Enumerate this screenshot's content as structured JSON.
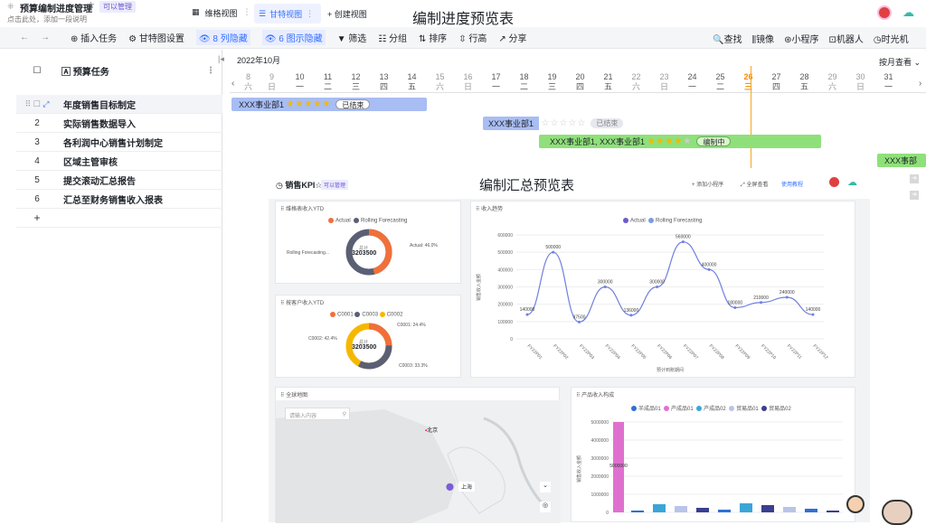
{
  "app": {
    "title": "预算编制进度管理",
    "star": "☆",
    "badge": "可以管理",
    "desc": "点击此处，添加一段说明",
    "tabs": [
      {
        "label": "维格视图"
      },
      {
        "label": "甘特视图"
      },
      {
        "label": "+ 创建视图"
      }
    ],
    "heading": "编制进度预览表"
  },
  "toolbar": {
    "insert": "插入任务",
    "gantt_settings": "甘特图设置",
    "hidden_cols": "8 列隐藏",
    "hidden_graphs": "6 图示隐藏",
    "filter": "筛选",
    "group": "分组",
    "sort": "排序",
    "row_height": "行高",
    "share": "分享",
    "search": "查找",
    "mirror": "镜像",
    "mini": "小程序",
    "robot": "机器人",
    "timemachine": "时光机"
  },
  "left": {
    "col_title": "预算任务",
    "add": "+",
    "rows": [
      {
        "num": "",
        "name": "年度销售目标制定"
      },
      {
        "num": "2",
        "name": "实际销售数据导入"
      },
      {
        "num": "3",
        "name": "各利润中心销售计划制定"
      },
      {
        "num": "4",
        "name": "区域主管审核"
      },
      {
        "num": "5",
        "name": "提交滚动汇总报告"
      },
      {
        "num": "6",
        "name": "汇总至财务销售收入报表"
      }
    ]
  },
  "calendar": {
    "month": "2022年10月",
    "view": "按月查看",
    "days": [
      {
        "d": "9",
        "w": "日"
      },
      {
        "d": "10",
        "w": "一"
      },
      {
        "d": "11",
        "w": "二"
      },
      {
        "d": "12",
        "w": "三"
      },
      {
        "d": "13",
        "w": "四"
      },
      {
        "d": "14",
        "w": "五"
      },
      {
        "d": "15",
        "w": "六"
      },
      {
        "d": "16",
        "w": "日"
      },
      {
        "d": "17",
        "w": "一"
      },
      {
        "d": "18",
        "w": "二"
      },
      {
        "d": "19",
        "w": "三"
      },
      {
        "d": "20",
        "w": "四"
      },
      {
        "d": "21",
        "w": "五"
      },
      {
        "d": "22",
        "w": "六"
      },
      {
        "d": "23",
        "w": "日"
      },
      {
        "d": "24",
        "w": "一"
      },
      {
        "d": "25",
        "w": "二"
      },
      {
        "d": "26",
        "w": "三"
      },
      {
        "d": "27",
        "w": "四"
      },
      {
        "d": "28",
        "w": "五"
      },
      {
        "d": "29",
        "w": "六"
      },
      {
        "d": "30",
        "w": "日"
      },
      {
        "d": "31",
        "w": "一"
      }
    ],
    "first": {
      "d": "8",
      "w": "六"
    }
  },
  "bars": [
    {
      "label": "XXX事业部1",
      "stars": 5,
      "status": "已结束"
    },
    {
      "label": "XXX事业部1",
      "stars": 0,
      "status": "已结束"
    },
    {
      "label": "XXX事业部1, XXX事业部1",
      "stars": 4,
      "status": "编制中"
    },
    {
      "label": "XXX事部"
    }
  ],
  "dashboard": {
    "title": "销售KPI",
    "badge": "可以管理",
    "heading": "编制汇总预览表",
    "add": "+ 添加小程序",
    "fullscreen": "全屏查看",
    "tutorial": "使用教程",
    "card1": {
      "title": "维格表收入YTD",
      "legend": [
        "Actual",
        "Rolling Forecasting"
      ],
      "total_label": "总计",
      "total": "3203500",
      "lbl_left": "Rolling Forecasting...",
      "lbl_right": "Actual: 46.0%"
    },
    "card2": {
      "title": "按客户收入YTD",
      "legend": [
        "C0001",
        "C0003",
        "C0002"
      ],
      "total_label": "总计",
      "total": "3203500",
      "lbl1": "C0001: 24.4%",
      "lbl2": "C0002: 42.4%",
      "lbl3": "C0003: 33.3%"
    },
    "card3": {
      "title": "收入趋势",
      "legend": [
        "Actual",
        "Rolling Forecasting"
      ],
      "ylabel": "销售收入金额",
      "xlabel": "预计到账期间",
      "yticks": [
        "600000",
        "500000",
        "400000",
        "300000",
        "200000",
        "100000",
        "0"
      ],
      "xticks": [
        "FY22P01",
        "FY22P02",
        "FY22P03",
        "FY22P04",
        "FY22P05",
        "FY22P06",
        "FY22P07",
        "FY22P08",
        "FY22P09",
        "FY22P10",
        "FY22P11",
        "FY22P12"
      ],
      "values": [
        140000,
        500000,
        97500,
        300000,
        136000,
        300000,
        560000,
        400000,
        180000,
        210000,
        240000,
        140000
      ],
      "vlabels": [
        "140000",
        "500000",
        "97500",
        "300000",
        "136000",
        "300000",
        "560000",
        "400000",
        "180000",
        "210000",
        "240000",
        "140000"
      ]
    },
    "card4": {
      "title": "全球地图",
      "search": "请输入内容",
      "city1": "北京",
      "city2": "上海"
    },
    "card5": {
      "title": "产品收入构成",
      "legend": [
        "半成品01",
        "产成品01",
        "产成品02",
        "贸易品01",
        "贸易品02"
      ],
      "ylabel": "销售收入金额",
      "yticks": [
        "5000000",
        "4000000",
        "3000000",
        "2000000",
        "1000000",
        "0"
      ],
      "big_label": "5000000"
    }
  }
}
